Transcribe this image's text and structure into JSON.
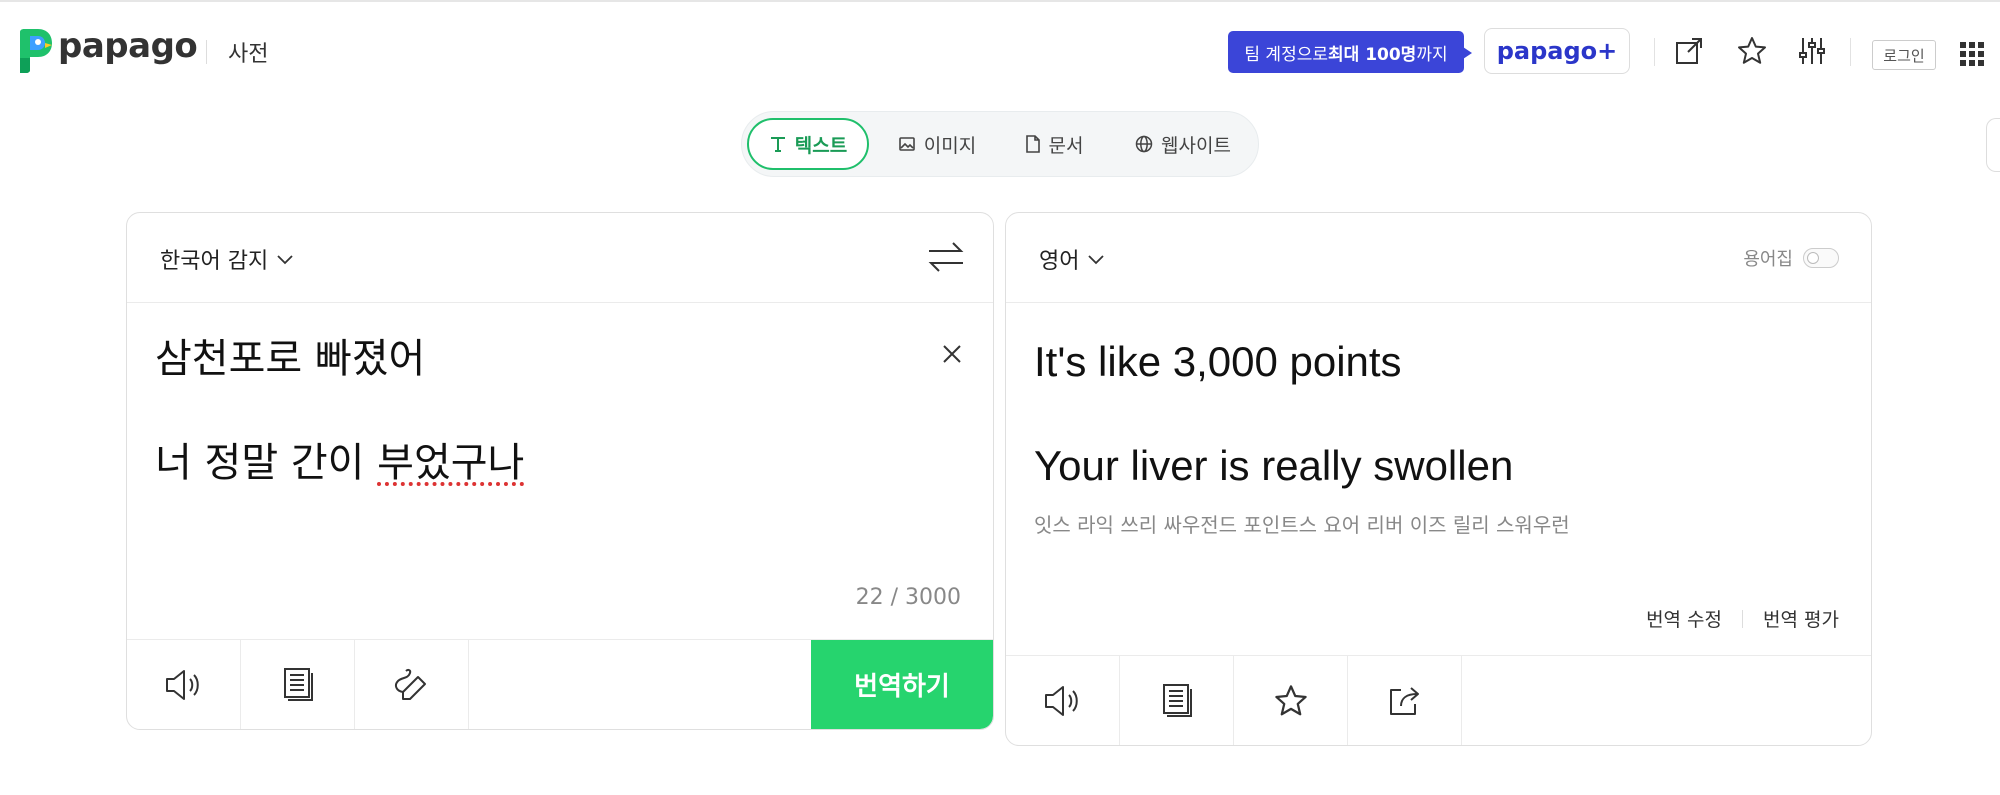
{
  "header": {
    "logo_text": "papago",
    "dict_label": "사전",
    "promo_prefix": "팀 계정으로 ",
    "promo_bold": "최대 100명",
    "promo_suffix": "까지",
    "plus_label": "papago+",
    "login_label": "로그인"
  },
  "tabs": [
    {
      "label": "텍스트",
      "icon": "text-icon",
      "active": true
    },
    {
      "label": "이미지",
      "icon": "image-icon",
      "active": false
    },
    {
      "label": "문서",
      "icon": "document-icon",
      "active": false
    },
    {
      "label": "웹사이트",
      "icon": "globe-icon",
      "active": false
    }
  ],
  "source": {
    "language": "한국어 감지",
    "line1": "삼천포로 빠졌어",
    "line2_prefix": "너 정말 간이 ",
    "line2_misspelled": "부었구나",
    "counter": "22 / 3000",
    "translate_button": "번역하기"
  },
  "target": {
    "language": "영어",
    "glossary_label": "용어집",
    "line1": "It's like 3,000 points",
    "line2": "Your liver is really swollen",
    "pronunciation": "잇스 라익 쓰리 싸우전드 포인트스 요어 리버 이즈 릴리 스워우런",
    "edit_label": "번역 수정",
    "rate_label": "번역 평가"
  },
  "colors": {
    "accent_green": "#26d46e",
    "promo_blue": "#3b45d8",
    "plus_blue": "#2b36c9"
  }
}
